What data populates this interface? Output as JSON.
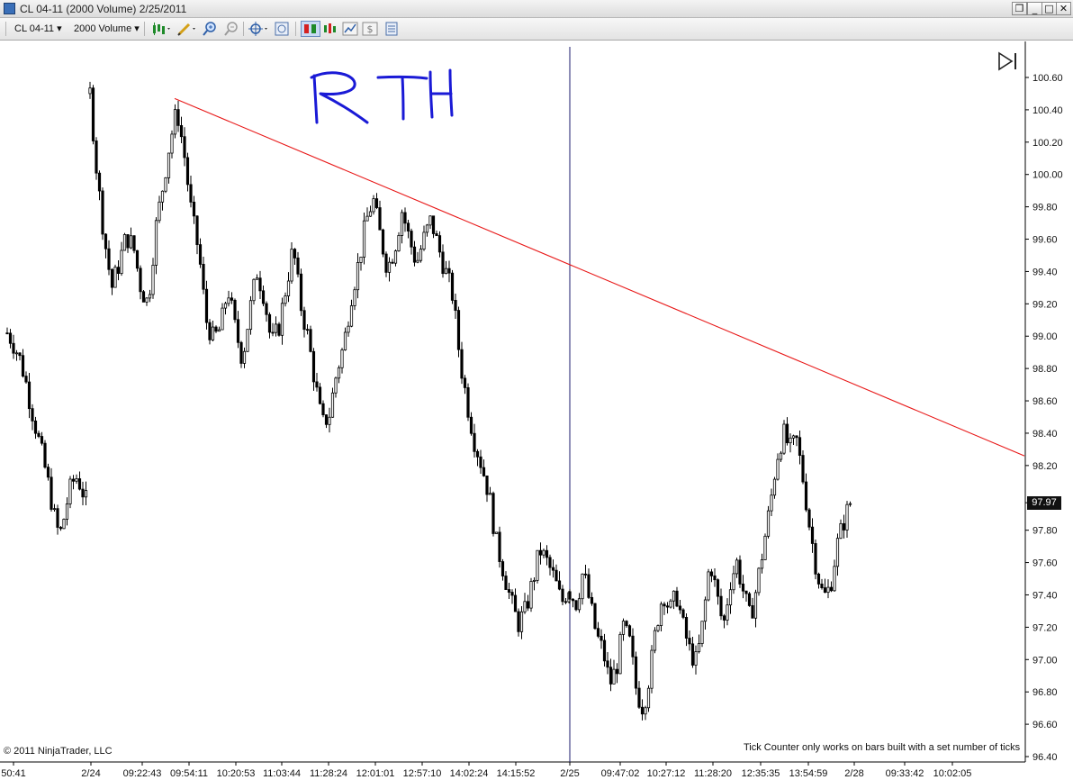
{
  "window": {
    "title": "CL 04-11 (2000 Volume)  2/25/2011",
    "buttons": {
      "restore": "❐",
      "minimize": "_",
      "maximize": "□",
      "close": "✕"
    }
  },
  "toolbar": {
    "instrument": "CL 04-11",
    "period": "2000 Volume",
    "dropdown_glyph": "▾",
    "icons": [
      "bar-type-icon",
      "drawing-tools-icon",
      "zoom-in-icon",
      "zoom-out-icon",
      "crosshair-icon",
      "data-box-icon",
      "chart-trader-icon",
      "strategies-icon",
      "indicators-icon",
      "properties-icon"
    ]
  },
  "annotation": {
    "text": "RTH",
    "color": "#1a1ad6"
  },
  "footer": {
    "copyright": "© 2011 NinjaTrader, LLC",
    "tick_counter_msg": "Tick Counter only works on bars built with a set number of ticks"
  },
  "colors": {
    "trendline": "#e81818",
    "separator": "#1b1b6e",
    "bar": "#000000",
    "grid_text": "#111111"
  },
  "chart_data": {
    "type": "candlestick",
    "instrument": "CL 04-11",
    "bar_period": "2000 Volume",
    "ylim": [
      96.4,
      100.6
    ],
    "y_ticks": [
      {
        "value": 100.6,
        "label": "100.60"
      },
      {
        "value": 100.4,
        "label": "100.40"
      },
      {
        "value": 100.2,
        "label": "100.20"
      },
      {
        "value": 100.0,
        "label": "100.00"
      },
      {
        "value": 99.8,
        "label": "99.80"
      },
      {
        "value": 99.6,
        "label": "99.60"
      },
      {
        "value": 99.4,
        "label": "99.40"
      },
      {
        "value": 99.2,
        "label": "99.20"
      },
      {
        "value": 99.0,
        "label": "99.00"
      },
      {
        "value": 98.8,
        "label": "98.80"
      },
      {
        "value": 98.6,
        "label": "98.60"
      },
      {
        "value": 98.4,
        "label": "98.40"
      },
      {
        "value": 98.2,
        "label": "98.20"
      },
      {
        "value": 97.8,
        "label": "97.80"
      },
      {
        "value": 97.6,
        "label": "97.60"
      },
      {
        "value": 97.4,
        "label": "97.40"
      },
      {
        "value": 97.2,
        "label": "97.20"
      },
      {
        "value": 97.0,
        "label": "97.00"
      },
      {
        "value": 96.8,
        "label": "96.80"
      },
      {
        "value": 96.6,
        "label": "96.60"
      },
      {
        "value": 96.4,
        "label": "96.40"
      }
    ],
    "x_labels": [
      "50:41",
      "2/24",
      "09:22:43",
      "09:54:11",
      "10:20:53",
      "11:03:44",
      "11:28:24",
      "12:01:01",
      "12:57:10",
      "14:02:24",
      "14:15:52",
      "2/25",
      "09:47:02",
      "10:27:12",
      "11:28:20",
      "12:35:35",
      "13:54:59",
      "2/28",
      "09:33:42",
      "10:02:05"
    ],
    "last_price": {
      "value": 97.97,
      "label": "97.97"
    },
    "day_separator_index": 1,
    "trendline": {
      "start": {
        "date": "2/24",
        "price": 100.47
      },
      "end_price": 98.26
    },
    "sessions": [
      {
        "from_label": "50:41",
        "to_label": "2/24",
        "path": [
          99.02,
          98.98,
          98.92,
          98.85,
          98.75,
          98.62,
          98.5,
          98.38,
          98.26,
          98.14,
          98.0,
          97.85,
          97.76,
          97.88,
          98.02,
          98.1,
          98.13,
          98.06,
          97.98
        ]
      },
      {
        "from_label": "2/24",
        "to_label": "2/25",
        "path": [
          100.5,
          99.98,
          99.6,
          99.3,
          99.45,
          99.62,
          99.55,
          99.3,
          99.2,
          99.65,
          99.92,
          100.2,
          100.4,
          100.12,
          99.75,
          99.52,
          99.1,
          98.98,
          99.05,
          99.3,
          99.05,
          98.86,
          99.15,
          99.4,
          99.25,
          98.95,
          99.05,
          99.3,
          99.55,
          99.2,
          99.0,
          98.72,
          98.45,
          98.52,
          98.78,
          98.95,
          99.25,
          99.45,
          99.7,
          99.85,
          99.62,
          99.42,
          99.55,
          99.78,
          99.6,
          99.45,
          99.6,
          99.72,
          99.55,
          99.4,
          99.25,
          98.85,
          98.58,
          98.35,
          98.2,
          98.02,
          97.72,
          97.55,
          97.36,
          97.22,
          97.3,
          97.48,
          97.68,
          97.6,
          97.5,
          97.35,
          97.45
        ]
      },
      {
        "from_label": "2/25",
        "to_label": "2/28",
        "path": [
          97.42,
          97.35,
          97.55,
          97.35,
          97.15,
          97.05,
          96.85,
          96.95,
          97.2,
          97.1,
          96.8,
          96.7,
          96.92,
          97.22,
          97.42,
          97.3,
          97.4,
          97.2,
          97.05,
          96.98,
          97.25,
          97.62,
          97.4,
          97.2,
          97.48,
          97.6,
          97.42,
          97.25,
          97.45,
          97.7,
          97.95,
          98.25,
          98.4,
          98.3,
          98.35,
          98.1,
          97.8,
          97.55,
          97.38,
          97.45,
          97.7,
          97.85,
          97.97
        ]
      }
    ]
  }
}
